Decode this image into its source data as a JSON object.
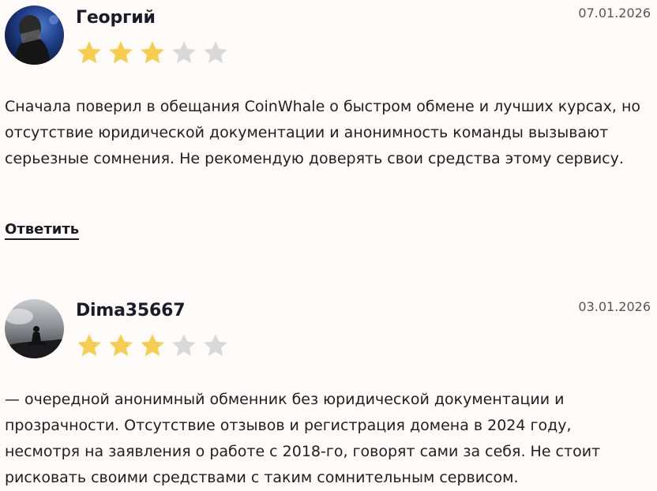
{
  "reviews": [
    {
      "author": "Георгий",
      "date": "07.01.2026",
      "rating": 3,
      "max_rating": 5,
      "text": "Сначала поверил в обещания CoinWhale о быстром обмене и лучших курсах, но отсутствие юридической документации и анонимность команды вызывают серьезные сомнения. Не рекомендую доверять свои средства этому сервису.",
      "reply_label": "Ответить"
    },
    {
      "author": "Dima35667",
      "date": "03.01.2026",
      "rating": 3,
      "max_rating": 5,
      "text": "— очередной анонимный обменник без юридической документации и прозрачности. Отсутствие отзывов и регистрация домена в 2024 году, несмотря на заявления о работе с 2018-го, говорят сами за себя. Не стоит рисковать своими средствами с таким сомнительным сервисом."
    }
  ],
  "colors": {
    "star_filled": "#f7cd4f",
    "star_empty": "#d9d9d9",
    "background": "#fefbf8"
  }
}
